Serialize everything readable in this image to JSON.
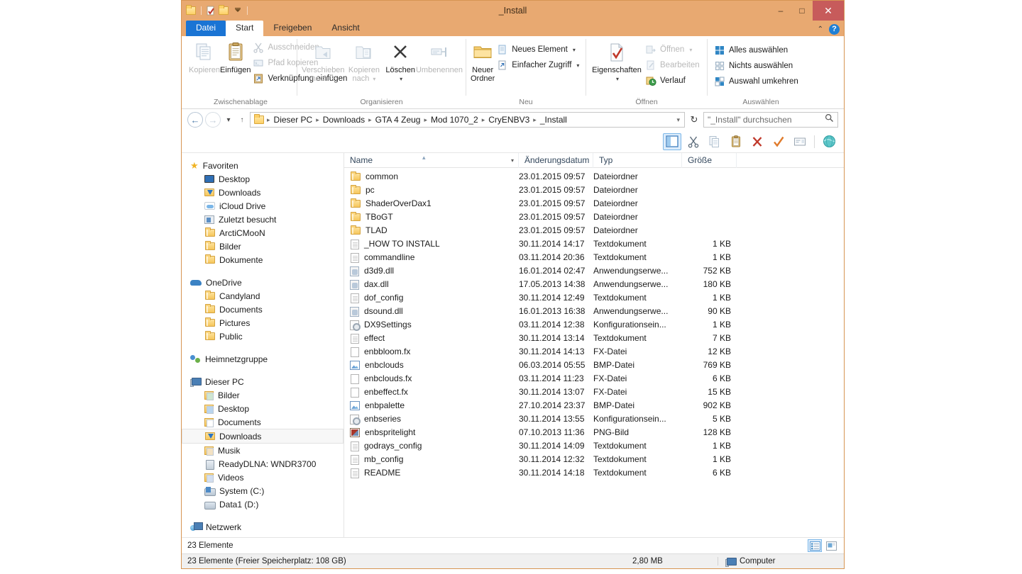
{
  "window": {
    "title": "_Install",
    "controls": {
      "minimize": "–",
      "maximize": "□",
      "close": "✕"
    },
    "quick_access": [
      "folder-icon",
      "properties-icon",
      "folder-icon",
      "chevron-down-icon"
    ]
  },
  "tabs": [
    {
      "label": "Datei",
      "kind": "file"
    },
    {
      "label": "Start",
      "kind": "active"
    },
    {
      "label": "Freigeben",
      "kind": "inactive"
    },
    {
      "label": "Ansicht",
      "kind": "inactive"
    }
  ],
  "tab_right": {
    "collapse": "⌃",
    "help": "?"
  },
  "ribbon": {
    "groups": [
      {
        "label": "Zwischenablage",
        "big": [
          {
            "label": "Kopieren",
            "icon": "copy-icon",
            "dim": true
          },
          {
            "label": "Einfügen",
            "icon": "paste-icon",
            "dim": false
          }
        ],
        "small": [
          {
            "label": "Ausschneiden",
            "icon": "scissors-icon",
            "dim": true
          },
          {
            "label": "Pfad kopieren",
            "icon": "copy-path-icon",
            "dim": true
          },
          {
            "label": "Verknüpfung einfügen",
            "icon": "paste-shortcut-icon",
            "dim": false
          }
        ]
      },
      {
        "label": "Organisieren",
        "big": [
          {
            "label": "Verschieben nach",
            "icon": "move-to-icon",
            "dim": true,
            "caret": true
          },
          {
            "label": "Kopieren nach",
            "icon": "copy-to-icon",
            "dim": true,
            "caret": true
          },
          {
            "label": "Löschen",
            "icon": "delete-icon",
            "dim": false,
            "caret": true
          },
          {
            "label": "Umbenennen",
            "icon": "rename-icon",
            "dim": true
          }
        ],
        "small": []
      },
      {
        "label": "Neu",
        "big": [
          {
            "label": "Neuer Ordner",
            "icon": "new-folder-icon",
            "dim": false
          }
        ],
        "small": [
          {
            "label": "Neues Element",
            "icon": "new-item-icon",
            "dim": false,
            "caret": true
          },
          {
            "label": "Einfacher Zugriff",
            "icon": "easy-access-icon",
            "dim": false,
            "caret": true
          }
        ]
      },
      {
        "label": "Öffnen",
        "big": [
          {
            "label": "Eigenschaften",
            "icon": "properties-icon",
            "dim": false,
            "caret": true
          }
        ],
        "small": [
          {
            "label": "Öffnen",
            "icon": "open-icon",
            "dim": true,
            "caret": true
          },
          {
            "label": "Bearbeiten",
            "icon": "edit-icon",
            "dim": true
          },
          {
            "label": "Verlauf",
            "icon": "history-icon",
            "dim": false
          }
        ]
      },
      {
        "label": "Auswählen",
        "big": [],
        "small": [
          {
            "label": "Alles auswählen",
            "icon": "select-all-icon",
            "dim": false
          },
          {
            "label": "Nichts auswählen",
            "icon": "select-none-icon",
            "dim": false
          },
          {
            "label": "Auswahl umkehren",
            "icon": "invert-selection-icon",
            "dim": false
          }
        ]
      }
    ]
  },
  "addressbar": {
    "back": "←",
    "forward": "→",
    "recent": "▾",
    "up": "↑",
    "breadcrumbs": [
      "Dieser PC",
      "Downloads",
      "GTA 4 Zeug",
      "Mod 1070_2",
      "CryENBV3",
      "_Install"
    ],
    "dropdown": "▾",
    "refresh": "↻",
    "search_placeholder": "\"_Install\" durchsuchen",
    "search_value": ""
  },
  "toolbar2": {
    "buttons": [
      {
        "name": "preview-pane-icon",
        "selected": true
      },
      {
        "name": "cut-icon",
        "selected": false
      },
      {
        "name": "copy-icon",
        "selected": false
      },
      {
        "name": "paste-icon",
        "selected": false
      },
      {
        "name": "delete-icon",
        "selected": false
      },
      {
        "name": "checkmark-icon",
        "selected": false
      },
      {
        "name": "rename-icon",
        "selected": false
      },
      {
        "name": "globe-icon",
        "selected": false
      }
    ]
  },
  "navpane": {
    "sections": [
      {
        "header": {
          "label": "Favoriten",
          "icon": "star-icon"
        },
        "items": [
          {
            "label": "Desktop",
            "icon": "desktop-icon"
          },
          {
            "label": "Downloads",
            "icon": "downloads-icon"
          },
          {
            "label": "iCloud Drive",
            "icon": "cloud-icon"
          },
          {
            "label": "Zuletzt besucht",
            "icon": "recent-icon"
          },
          {
            "label": "ArctiCMooN",
            "icon": "folder-icon"
          },
          {
            "label": "Bilder",
            "icon": "folder-icon"
          },
          {
            "label": "Dokumente",
            "icon": "folder-icon"
          }
        ]
      },
      {
        "header": {
          "label": "OneDrive",
          "icon": "onedrive-icon"
        },
        "items": [
          {
            "label": "Candyland",
            "icon": "folder-icon"
          },
          {
            "label": "Documents",
            "icon": "folder-icon"
          },
          {
            "label": "Pictures",
            "icon": "folder-icon"
          },
          {
            "label": "Public",
            "icon": "folder-icon"
          }
        ]
      },
      {
        "header": {
          "label": "Heimnetzgruppe",
          "icon": "homegroup-icon"
        },
        "items": []
      },
      {
        "header": {
          "label": "Dieser PC",
          "icon": "pc-icon"
        },
        "items": [
          {
            "label": "Bilder",
            "icon": "pictures-folder-icon"
          },
          {
            "label": "Desktop",
            "icon": "desktop-folder-icon"
          },
          {
            "label": "Documents",
            "icon": "documents-folder-icon"
          },
          {
            "label": "Downloads",
            "icon": "downloads-icon",
            "selected": true
          },
          {
            "label": "Musik",
            "icon": "music-folder-icon"
          },
          {
            "label": "ReadyDLNA: WNDR3700",
            "icon": "media-server-icon"
          },
          {
            "label": "Videos",
            "icon": "videos-folder-icon"
          },
          {
            "label": "System (C:)",
            "icon": "system-drive-icon"
          },
          {
            "label": "Data1 (D:)",
            "icon": "drive-icon"
          }
        ]
      },
      {
        "header": {
          "label": "Netzwerk",
          "icon": "network-icon"
        },
        "items": []
      }
    ]
  },
  "filelist": {
    "columns": [
      {
        "key": "name",
        "label": "Name"
      },
      {
        "key": "date",
        "label": "Änderungsdatum"
      },
      {
        "key": "type",
        "label": "Typ"
      },
      {
        "key": "size",
        "label": "Größe"
      }
    ],
    "sorted_by": "Name",
    "sort_direction": "asc",
    "rows": [
      {
        "name": "common",
        "date": "23.01.2015 09:57",
        "type": "Dateiordner",
        "size": "",
        "icon": "folder"
      },
      {
        "name": "pc",
        "date": "23.01.2015 09:57",
        "type": "Dateiordner",
        "size": "",
        "icon": "folder"
      },
      {
        "name": "ShaderOverDax1",
        "date": "23.01.2015 09:57",
        "type": "Dateiordner",
        "size": "",
        "icon": "folder"
      },
      {
        "name": "TBoGT",
        "date": "23.01.2015 09:57",
        "type": "Dateiordner",
        "size": "",
        "icon": "folder"
      },
      {
        "name": "TLAD",
        "date": "23.01.2015 09:57",
        "type": "Dateiordner",
        "size": "",
        "icon": "folder"
      },
      {
        "name": "_HOW TO INSTALL",
        "date": "30.11.2014 14:17",
        "type": "Textdokument",
        "size": "1 KB",
        "icon": "doc"
      },
      {
        "name": "commandline",
        "date": "03.11.2014 20:36",
        "type": "Textdokument",
        "size": "1 KB",
        "icon": "doc"
      },
      {
        "name": "d3d9.dll",
        "date": "16.01.2014 02:47",
        "type": "Anwendungserwe...",
        "size": "752 KB",
        "icon": "dll"
      },
      {
        "name": "dax.dll",
        "date": "17.05.2013 14:38",
        "type": "Anwendungserwe...",
        "size": "180 KB",
        "icon": "dll"
      },
      {
        "name": "dof_config",
        "date": "30.11.2014 12:49",
        "type": "Textdokument",
        "size": "1 KB",
        "icon": "doc"
      },
      {
        "name": "dsound.dll",
        "date": "16.01.2013 16:38",
        "type": "Anwendungserwe...",
        "size": "90 KB",
        "icon": "dll"
      },
      {
        "name": "DX9Settings",
        "date": "03.11.2014 12:38",
        "type": "Konfigurationsein...",
        "size": "1 KB",
        "icon": "cfg"
      },
      {
        "name": "effect",
        "date": "30.11.2014 13:14",
        "type": "Textdokument",
        "size": "7 KB",
        "icon": "doc"
      },
      {
        "name": "enbbloom.fx",
        "date": "30.11.2014 14:13",
        "type": "FX-Datei",
        "size": "12 KB",
        "icon": "blank"
      },
      {
        "name": "enbclouds",
        "date": "06.03.2014 05:55",
        "type": "BMP-Datei",
        "size": "769 KB",
        "icon": "bmp"
      },
      {
        "name": "enbclouds.fx",
        "date": "03.11.2014 11:23",
        "type": "FX-Datei",
        "size": "6 KB",
        "icon": "blank"
      },
      {
        "name": "enbeffect.fx",
        "date": "30.11.2014 13:07",
        "type": "FX-Datei",
        "size": "15 KB",
        "icon": "blank"
      },
      {
        "name": "enbpalette",
        "date": "27.10.2014 23:37",
        "type": "BMP-Datei",
        "size": "902 KB",
        "icon": "bmp"
      },
      {
        "name": "enbseries",
        "date": "30.11.2014 13:55",
        "type": "Konfigurationsein...",
        "size": "5 KB",
        "icon": "cfg"
      },
      {
        "name": "enbspritelight",
        "date": "07.10.2013 11:36",
        "type": "PNG-Bild",
        "size": "128 KB",
        "icon": "png"
      },
      {
        "name": "godrays_config",
        "date": "30.11.2014 14:09",
        "type": "Textdokument",
        "size": "1 KB",
        "icon": "doc"
      },
      {
        "name": "mb_config",
        "date": "30.11.2014 12:32",
        "type": "Textdokument",
        "size": "1 KB",
        "icon": "doc"
      },
      {
        "name": "README",
        "date": "30.11.2014 14:18",
        "type": "Textdokument",
        "size": "6 KB",
        "icon": "doc"
      }
    ]
  },
  "status": {
    "detail_count": "23 Elemente",
    "full_text": "23 Elemente (Freier Speicherplatz: 108 GB)",
    "size": "2,80 MB",
    "location": "Computer",
    "view_buttons": [
      "details-view-icon",
      "large-icons-view-icon"
    ]
  },
  "colors": {
    "frame": "#e8a971",
    "file_tab": "#1a74d4",
    "close_button": "#c75b5b",
    "selection": "#dcecfb"
  }
}
